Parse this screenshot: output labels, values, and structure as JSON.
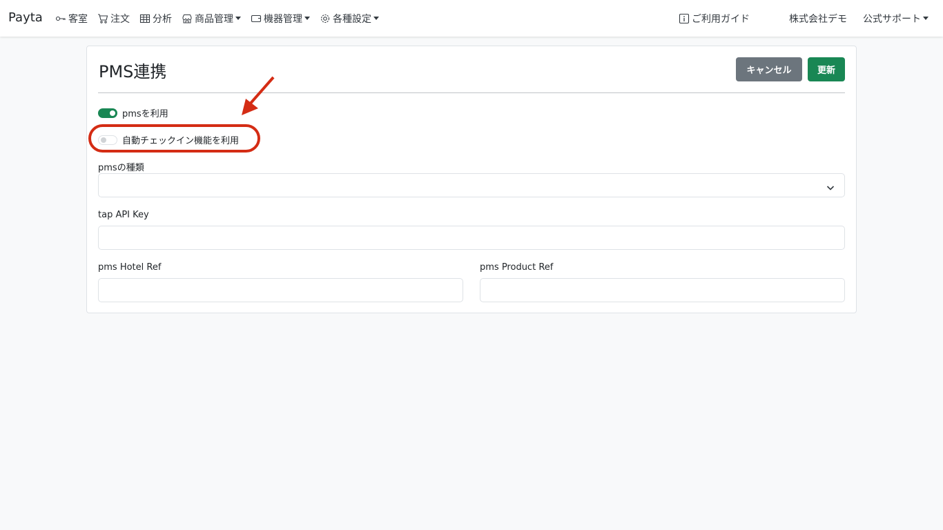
{
  "brand": "Payta",
  "nav": {
    "guestroom": "客室",
    "orders": "注文",
    "analytics": "分析",
    "products": "商品管理",
    "devices": "機器管理",
    "settings": "各種設定",
    "guide": "ご利用ガイド",
    "company": "株式会社デモ",
    "support": "公式サポート"
  },
  "page": {
    "title": "PMS連携",
    "cancel_label": "キャンセル",
    "update_label": "更新"
  },
  "switches": {
    "use_pms": {
      "label": "pmsを利用",
      "checked": true
    },
    "auto_checkin": {
      "label": "自動チェックイン機能を利用",
      "checked": false
    }
  },
  "form": {
    "pms_type": {
      "label": "pmsの種類",
      "value": ""
    },
    "tap_api_key": {
      "label": "tap API Key",
      "value": ""
    },
    "pms_hotel_ref": {
      "label": "pms Hotel Ref",
      "value": ""
    },
    "pms_product_ref": {
      "label": "pms Product Ref",
      "value": ""
    }
  },
  "colors": {
    "accent": "#198754",
    "secondary": "#6c757d",
    "annotation": "#d42c14"
  },
  "icons": [
    "key-icon",
    "cart-icon",
    "table-icon",
    "shop-icon",
    "wallet-icon",
    "gear-icon",
    "info-icon",
    "chevron-down-icon"
  ]
}
